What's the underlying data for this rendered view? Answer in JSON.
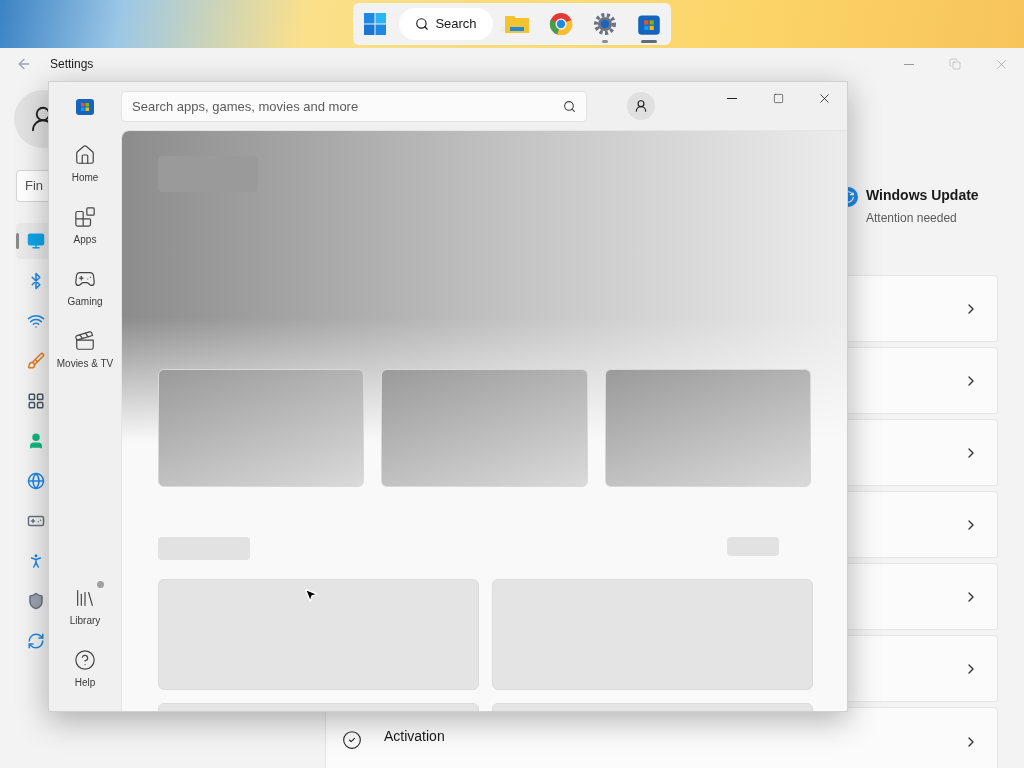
{
  "taskbar": {
    "search_label": "Search",
    "apps": [
      {
        "kind": "start",
        "running": false,
        "selected": false
      },
      {
        "kind": "search",
        "running": false,
        "selected": false
      },
      {
        "kind": "folder",
        "running": false,
        "selected": false
      },
      {
        "kind": "browser",
        "running": false,
        "selected": false
      },
      {
        "kind": "settings",
        "running": true,
        "selected": false
      },
      {
        "kind": "store",
        "running": true,
        "selected": true
      }
    ]
  },
  "settings_window": {
    "title": "Settings",
    "search_value": "Fin",
    "nav": [
      {
        "selected": true
      },
      {
        "selected": false
      },
      {
        "selected": false
      },
      {
        "selected": false
      },
      {
        "selected": false
      },
      {
        "selected": false
      },
      {
        "selected": false
      },
      {
        "selected": false
      },
      {
        "selected": false
      },
      {
        "selected": false
      },
      {
        "selected": false
      }
    ],
    "status": {
      "title": "Windows Update",
      "subtitle": "Attention needed"
    },
    "cards": [
      {
        "kind": "blank"
      },
      {
        "kind": "blank"
      },
      {
        "kind": "blank"
      },
      {
        "kind": "blank"
      },
      {
        "kind": "blank"
      },
      {
        "kind": "blank"
      },
      {
        "kind": "activation",
        "title": "Activation"
      }
    ]
  },
  "store_window": {
    "search_placeholder": "Search apps, games, movies and more",
    "nav": [
      {
        "label": "Home",
        "selected": false,
        "notification": false
      },
      {
        "label": "Apps",
        "selected": false,
        "notification": false
      },
      {
        "label": "Gaming",
        "selected": false,
        "notification": false
      },
      {
        "label": "Movies & TV",
        "selected": false,
        "notification": false
      }
    ],
    "nav_bottom": [
      {
        "label": "Library",
        "selected": false,
        "notification": true
      },
      {
        "label": "Help",
        "selected": false,
        "notification": false
      }
    ]
  }
}
